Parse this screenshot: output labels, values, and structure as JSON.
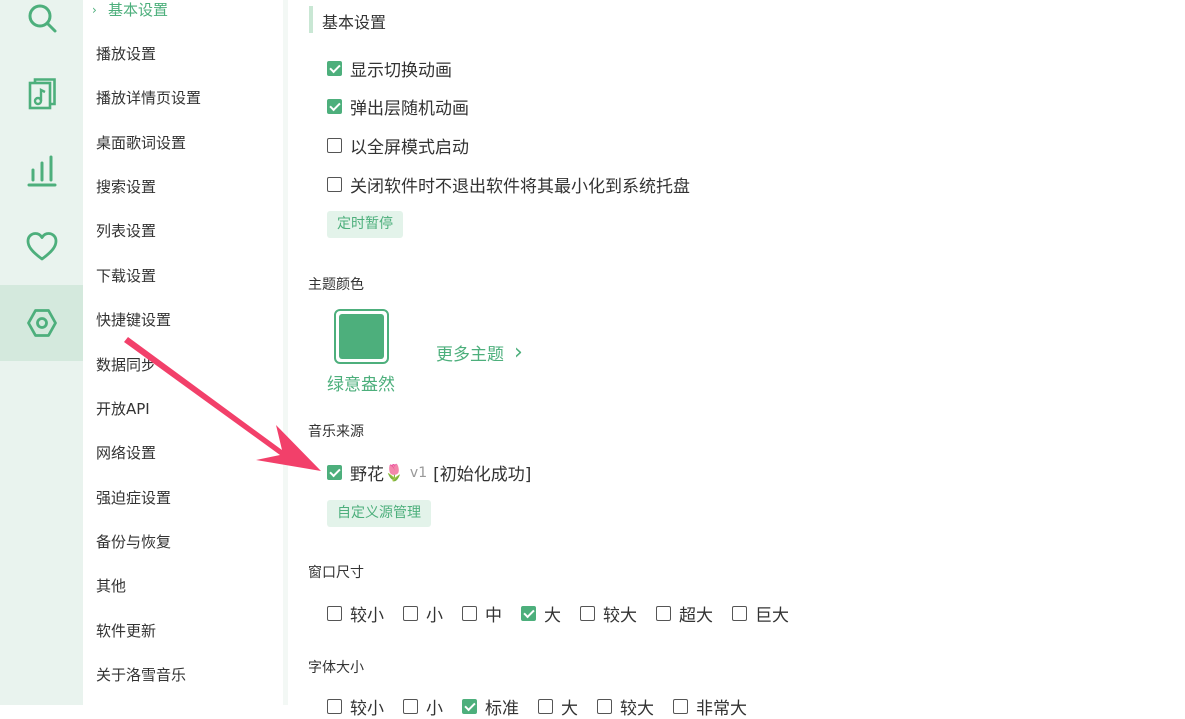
{
  "theme": {
    "accent": "#4daf7c",
    "rail_bg": "#e9f3ee",
    "rail_active_bg": "#d4e9dd",
    "arrow_color": "#f2406a"
  },
  "rail": {
    "items": [
      {
        "icon": "search-icon",
        "active": false
      },
      {
        "icon": "music-list-icon",
        "active": false
      },
      {
        "icon": "chart-bars-icon",
        "active": false
      },
      {
        "icon": "heart-icon",
        "active": false
      },
      {
        "icon": "settings-hexagon-icon",
        "active": true
      }
    ]
  },
  "nav": {
    "items": [
      {
        "label": "基本设置",
        "active": true
      },
      {
        "label": "播放设置"
      },
      {
        "label": "播放详情页设置"
      },
      {
        "label": "桌面歌词设置"
      },
      {
        "label": "搜索设置"
      },
      {
        "label": "列表设置"
      },
      {
        "label": "下载设置"
      },
      {
        "label": "快捷键设置"
      },
      {
        "label": "数据同步"
      },
      {
        "label": "开放API"
      },
      {
        "label": "网络设置"
      },
      {
        "label": "强迫症设置"
      },
      {
        "label": "备份与恢复"
      },
      {
        "label": "其他"
      },
      {
        "label": "软件更新"
      },
      {
        "label": "关于洛雪音乐"
      }
    ]
  },
  "basic": {
    "title": "基本设置",
    "options": [
      {
        "label": "显示切换动画",
        "checked": true
      },
      {
        "label": "弹出层随机动画",
        "checked": true
      },
      {
        "label": "以全屏模式启动",
        "checked": false
      },
      {
        "label": "关闭软件时不退出软件将其最小化到系统托盘",
        "checked": false
      }
    ],
    "timer_button": "定时暂停"
  },
  "theme_section": {
    "label": "主题颜色",
    "current_name": "绿意盎然",
    "more_link": "更多主题",
    "more_chevron": "›"
  },
  "source": {
    "label": "音乐来源",
    "item": {
      "name": "野花",
      "emoji": "🌷",
      "version": "v1",
      "status": "[初始化成功]",
      "checked": true
    },
    "manage_button": "自定义源管理"
  },
  "window_size": {
    "label": "窗口尺寸",
    "options": [
      {
        "label": "较小",
        "checked": false
      },
      {
        "label": "小",
        "checked": false
      },
      {
        "label": "中",
        "checked": false
      },
      {
        "label": "大",
        "checked": true
      },
      {
        "label": "较大",
        "checked": false
      },
      {
        "label": "超大",
        "checked": false
      },
      {
        "label": "巨大",
        "checked": false
      }
    ]
  },
  "font_size": {
    "label": "字体大小",
    "options": [
      {
        "label": "较小",
        "checked": false
      },
      {
        "label": "小",
        "checked": false
      },
      {
        "label": "标准",
        "checked": true
      },
      {
        "label": "大",
        "checked": false
      },
      {
        "label": "较大",
        "checked": false
      },
      {
        "label": "非常大",
        "checked": false
      }
    ]
  }
}
